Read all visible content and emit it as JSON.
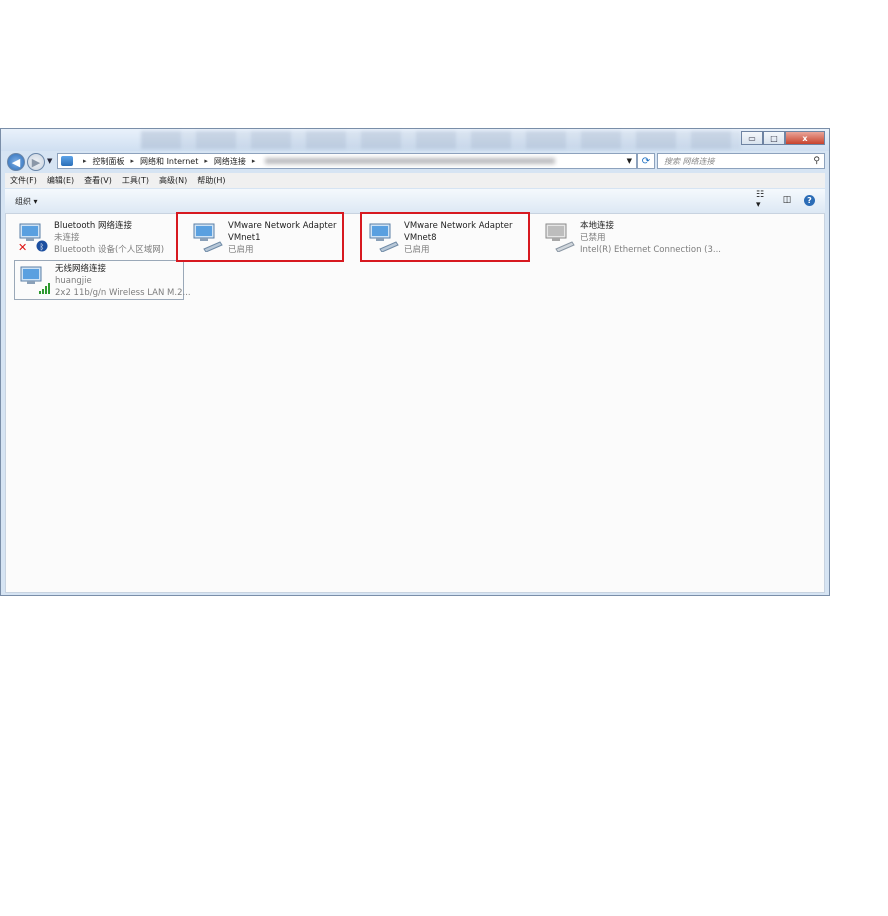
{
  "window": {
    "close_label": "x",
    "maximize_label": "□",
    "minimize_label": "▭"
  },
  "address": {
    "crumbs": [
      "控制面板",
      "网络和 Internet",
      "网络连接"
    ],
    "search_placeholder": "搜索 网络连接"
  },
  "menu": [
    "文件(F)",
    "编辑(E)",
    "查看(V)",
    "工具(T)",
    "高级(N)",
    "帮助(H)"
  ],
  "toolbar": {
    "organize_label": "组织 ▾",
    "help_label": "?"
  },
  "adapters": [
    {
      "name": "Bluetooth 网络连接",
      "status": "未连接",
      "device": "Bluetooth 设备(个人区域网)",
      "icon": "network-disconnected-bluetooth-icon"
    },
    {
      "name": "VMware Network Adapter VMnet1",
      "status": "已启用",
      "device": "",
      "icon": "network-adapter-icon"
    },
    {
      "name": "VMware Network Adapter VMnet8",
      "status": "已启用",
      "device": "",
      "icon": "network-adapter-icon"
    },
    {
      "name": "本地连接",
      "status": "已禁用",
      "device": "Intel(R) Ethernet Connection (3...",
      "icon": "network-disabled-icon"
    },
    {
      "name": "无线网络连接",
      "status": "huangjie",
      "device": "2x2 11b/g/n Wireless LAN M.2...",
      "icon": "wireless-signal-icon"
    }
  ],
  "colors": {
    "highlight_border": "#d71920",
    "accent": "#1b6ec2"
  }
}
